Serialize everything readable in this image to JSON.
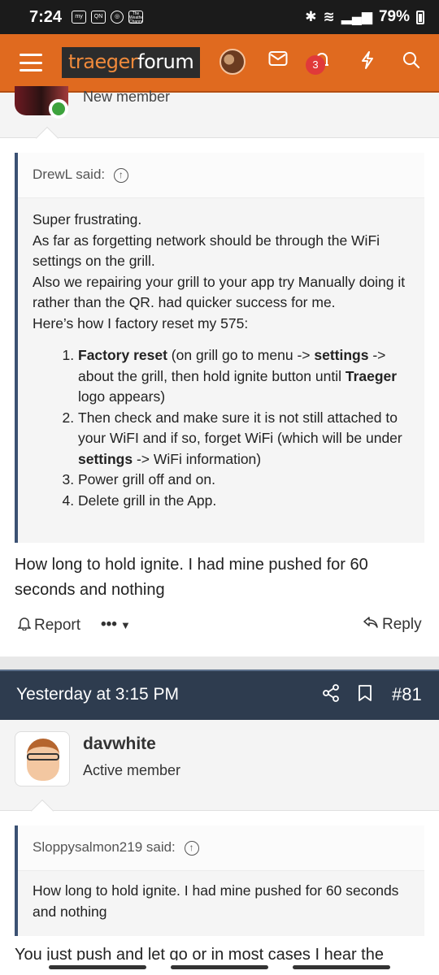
{
  "status_bar": {
    "time": "7:24",
    "battery": "79%",
    "notif_icons": [
      "my Q",
      "QN",
      "chrome",
      "The Weather Channel"
    ]
  },
  "header": {
    "logo_part1": "traeger",
    "logo_part2": "forum",
    "alerts_badge": "3"
  },
  "post1": {
    "author_role": "New member",
    "quote": {
      "author": "DrewL said:",
      "lines": [
        "Super frustrating.",
        "As far as forgetting network should be through the WiFi settings on the grill.",
        "Also we repairing your grill to your app try Manually doing it rather than the QR. had quicker success for me.",
        "Here’s how I factory reset my 575:"
      ],
      "steps": {
        "s1_b1": "Factory reset",
        "s1_t1": " (on grill go to menu -> ",
        "s1_b2": "settings",
        "s1_t2": " -> about the grill, then hold ignite button until ",
        "s1_b3": "Traeger",
        "s1_t3": " logo appears)",
        "s2_t1": "Then check and make sure it is not still attached to your WiFI and if so, forget WiFi (which will be under ",
        "s2_b1": "settings",
        "s2_t2": " -> WiFi information)",
        "s3": "Power grill off and on.",
        "s4": "Delete grill in the App."
      }
    },
    "text": "How long to hold ignite. I had mine pushed for 60 seconds and nothing",
    "actions": {
      "report": "Report",
      "more": "•••",
      "reply": "Reply"
    }
  },
  "post2": {
    "date": "Yesterday at 3:15 PM",
    "number": "#81",
    "author": "davwhite",
    "author_role": "Active member",
    "quote": {
      "author": "Sloppysalmon219 said:",
      "text": "How long to hold ignite. I had mine pushed for 60 seconds and nothing"
    },
    "text_partial": "You just push and let go or in most cases I hear the"
  }
}
